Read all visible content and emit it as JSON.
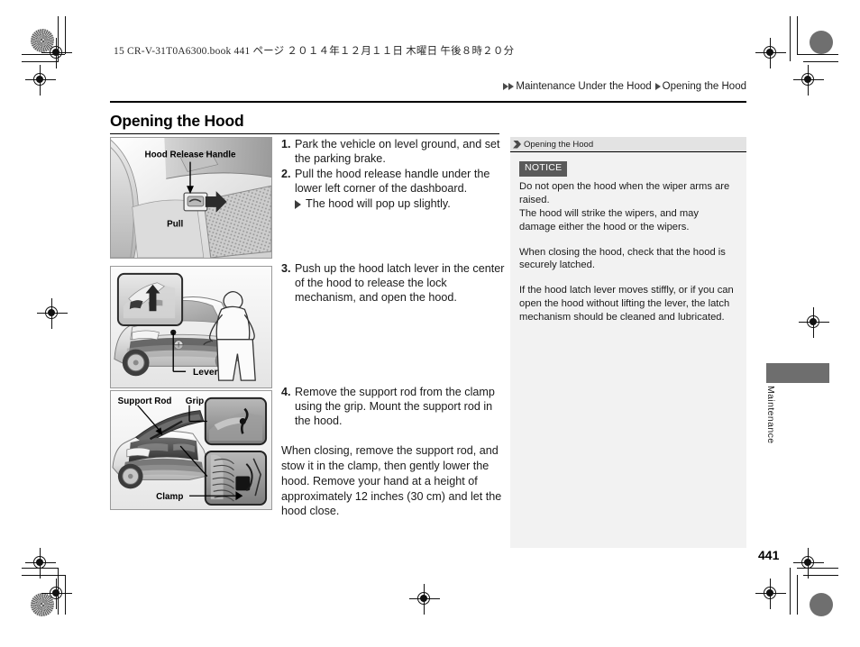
{
  "print_header": {
    "book_line": "15 CR-V-31T0A6300.book   441 ページ   ２０１４年１２月１１日   木曜日   午後８時２０分"
  },
  "breadcrumb": {
    "parent": "Maintenance Under the Hood",
    "current": "Opening the Hood"
  },
  "section": {
    "title": "Opening the Hood"
  },
  "steps": [
    {
      "number": "1.",
      "text": "Park the vehicle on level ground, and set the parking brake.",
      "substeps": []
    },
    {
      "number": "2.",
      "text": "Pull the hood release handle under the lower left corner of the dashboard.",
      "substeps": [
        "The hood will pop up slightly."
      ]
    },
    {
      "number": "3.",
      "text": "Push up the hood latch lever in the center of the hood to release the lock mechanism, and open the hood.",
      "substeps": []
    },
    {
      "number": "4.",
      "text": "Remove the support rod from the clamp using the grip. Mount the support rod in the hood.",
      "substeps": []
    }
  ],
  "closing_paragraph": "When closing, remove the support rod, and stow it in the clamp, then gently lower the hood. Remove your hand at a height of approximately 12 inches (30 cm) and let the hood close.",
  "figures": [
    {
      "id": "fig-hood-release-handle",
      "labels": [
        "Hood Release Handle",
        "Pull"
      ]
    },
    {
      "id": "fig-hood-latch-lever",
      "labels": [
        "Lever"
      ]
    },
    {
      "id": "fig-support-rod",
      "labels": [
        "Support Rod",
        "Grip",
        "Clamp"
      ]
    }
  ],
  "side_panel": {
    "header": "Opening the Hood",
    "notice_badge": "NOTICE",
    "paragraphs": [
      "Do not open the hood when the wiper arms are raised.",
      "The hood will strike the wipers, and may damage either the hood or the wipers.",
      "When closing the hood, check that the hood is securely latched.",
      "If the hood latch lever moves stiffly, or if you can open the hood without lifting the lever, the latch mechanism should be cleaned and lubricated."
    ]
  },
  "thumb_tab": {
    "label": "Maintenance"
  },
  "page_number": "441",
  "colors": {
    "tab_gray": "#6e6e6e",
    "panel_bg": "#f2f2f2",
    "notice_bg": "#5a5a5a"
  }
}
